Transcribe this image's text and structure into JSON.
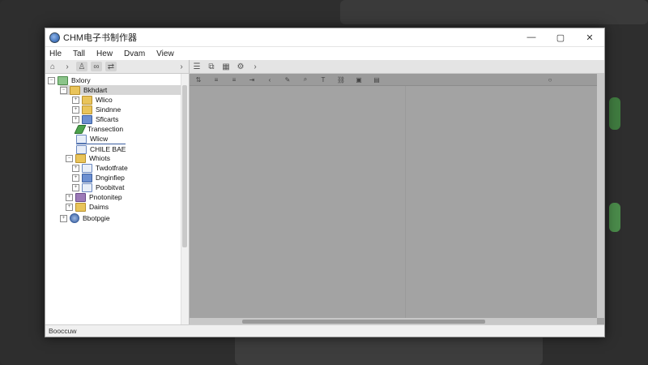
{
  "window": {
    "title": "CHM电子书制作器",
    "controls": {
      "minimize": "—",
      "maximize": "▢",
      "close": "✕"
    }
  },
  "menu": [
    "Hle",
    "Tall",
    "Hew",
    "Dvam",
    "View"
  ],
  "tree": {
    "root": "Bxlory",
    "items": [
      {
        "label": "Bkhdart",
        "icon": "folder-icon",
        "selected": true
      },
      {
        "label": "Wlico",
        "icon": "folder-icon"
      },
      {
        "label": "Sindnne",
        "icon": "folder-icon"
      },
      {
        "label": "Sflcarts",
        "icon": "link-icon"
      },
      {
        "label": "Transection",
        "icon": "pen-icon"
      },
      {
        "label": "Wlicw",
        "icon": "document-icon"
      },
      {
        "label": "CHILE BAE",
        "icon": "document-icon"
      },
      {
        "label": "Whiots",
        "icon": "folder-icon"
      },
      {
        "label": "Twdotfrate",
        "icon": "document-icon"
      },
      {
        "label": "Dnginfiep",
        "icon": "image-icon"
      },
      {
        "label": "Poobitvat",
        "icon": "document-icon"
      },
      {
        "label": "Pnotonitep",
        "icon": "user-icon"
      },
      {
        "label": "Daims",
        "icon": "folder-icon"
      },
      {
        "label": "Bbotpgie",
        "icon": "globe-icon"
      }
    ]
  },
  "status": {
    "text": "Booccuw"
  }
}
